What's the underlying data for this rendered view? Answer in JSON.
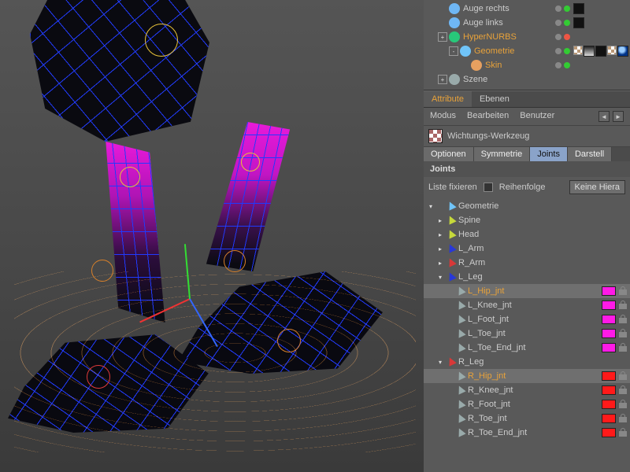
{
  "hierarchy": {
    "items": [
      {
        "label": "Auge rechts",
        "icon": "#6fb7f5",
        "selected": false,
        "sdots": [
          "dg",
          "dgr"
        ],
        "tags": [
          "blk"
        ]
      },
      {
        "label": "Auge links",
        "icon": "#6fb7f5",
        "selected": false,
        "sdots": [
          "dg",
          "dgr"
        ],
        "tags": [
          "blk"
        ]
      },
      {
        "label": "HyperNURBS",
        "icon": "#28c87a",
        "selected": true,
        "exp": "+",
        "sdots": [
          "dg",
          "dr"
        ],
        "tags": []
      },
      {
        "label": "Geometrie",
        "icon": "#70c4f8",
        "selected": true,
        "indent": 1,
        "exp": "-",
        "sdots": [
          "dg",
          "dgr"
        ],
        "tags": [
          "chk",
          "grad",
          "blk",
          "chk",
          "blue"
        ]
      },
      {
        "label": "Skin",
        "icon": "#e6a060",
        "selected": true,
        "indent": 2,
        "sdots": [
          "dg",
          "dgr"
        ],
        "tags": []
      },
      {
        "label": "Szene",
        "icon": "#9aa",
        "selected": false,
        "exp": "+",
        "sdots": [],
        "tags": []
      }
    ]
  },
  "attr": {
    "tabs": {
      "attribute": "Attribute",
      "ebenen": "Ebenen"
    },
    "menu": {
      "modus": "Modus",
      "bearbeiten": "Bearbeiten",
      "benutzer": "Benutzer"
    },
    "tool_label": "Wichtungs-Werkzeug",
    "subtabs": {
      "optionen": "Optionen",
      "symmetrie": "Symmetrie",
      "joints": "Joints",
      "darstell": "Darstell"
    },
    "section": "Joints",
    "filter": {
      "fix": "Liste fixieren",
      "order": "Reihenfolge",
      "orderbtn": "Keine Hiera"
    }
  },
  "jtree": {
    "root": "Geometrie",
    "nodes": [
      {
        "label": "Spine",
        "color": "#c6d83a",
        "depth": 1,
        "exp": ">"
      },
      {
        "label": "Head",
        "color": "#c6d83a",
        "depth": 1,
        "exp": ">"
      },
      {
        "label": "L_Arm",
        "color": "#2838d8",
        "depth": 1,
        "exp": ">"
      },
      {
        "label": "R_Arm",
        "color": "#d83838",
        "depth": 1,
        "exp": ">"
      },
      {
        "label": "L_Leg",
        "color": "#2838d8",
        "depth": 1,
        "exp": "v"
      },
      {
        "label": "L_Hip_jnt",
        "color": "#9aa",
        "depth": 2,
        "sel": true,
        "swatch": "#ff1ae6",
        "lock": true
      },
      {
        "label": "L_Knee_jnt",
        "color": "#9aa",
        "depth": 2,
        "swatch": "#ff1ae6",
        "lock": true
      },
      {
        "label": "L_Foot_jnt",
        "color": "#9aa",
        "depth": 2,
        "swatch": "#ff1ae6",
        "lock": true
      },
      {
        "label": "L_Toe_jnt",
        "color": "#9aa",
        "depth": 2,
        "swatch": "#ff1ae6",
        "lock": true
      },
      {
        "label": "L_Toe_End_jnt",
        "color": "#9aa",
        "depth": 2,
        "swatch": "#ff1ae6",
        "lock": true
      },
      {
        "label": "R_Leg",
        "color": "#d83838",
        "depth": 1,
        "exp": "v"
      },
      {
        "label": "R_Hip_jnt",
        "color": "#9aa",
        "depth": 2,
        "sel": true,
        "swatch": "#ff1a1a",
        "lock": true
      },
      {
        "label": "R_Knee_jnt",
        "color": "#9aa",
        "depth": 2,
        "swatch": "#ff1a1a",
        "lock": true
      },
      {
        "label": "R_Foot_jnt",
        "color": "#9aa",
        "depth": 2,
        "swatch": "#ff1a1a",
        "lock": true
      },
      {
        "label": "R_Toe_jnt",
        "color": "#9aa",
        "depth": 2,
        "swatch": "#ff1a1a",
        "lock": true
      },
      {
        "label": "R_Toe_End_jnt",
        "color": "#9aa",
        "depth": 2,
        "swatch": "#ff1a1a",
        "lock": true
      }
    ]
  }
}
